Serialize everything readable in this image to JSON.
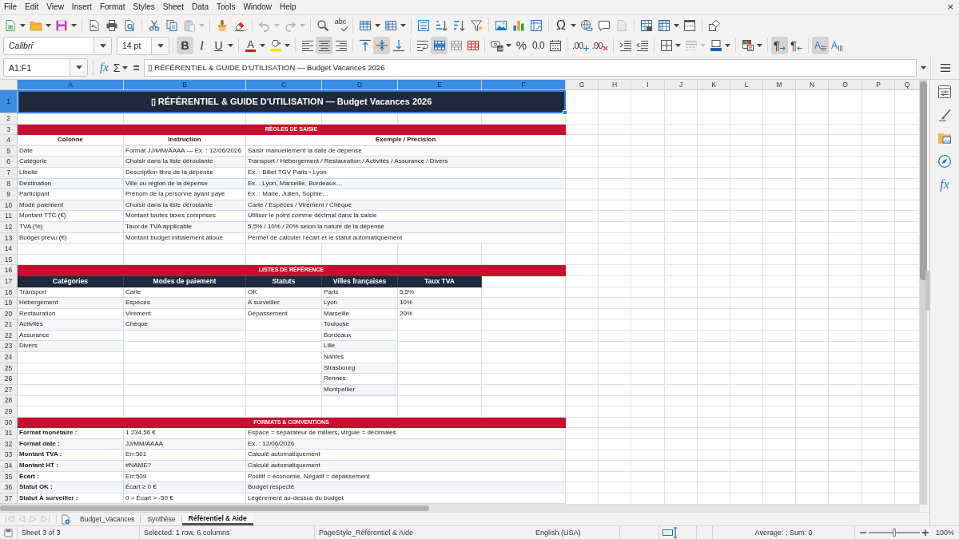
{
  "menu_bar": {
    "items": [
      "File",
      "Edit",
      "View",
      "Insert",
      "Format",
      "Styles",
      "Sheet",
      "Data",
      "Tools",
      "Window",
      "Help"
    ],
    "close": "×"
  },
  "standard_toolbar": {
    "groups": [
      [
        {
          "kind": "new",
          "dropdown": true,
          "disabled": false
        },
        {
          "kind": "open",
          "dropdown": true,
          "disabled": false
        },
        {
          "kind": "save",
          "dropdown": true,
          "disabled": false
        }
      ],
      [
        {
          "kind": "pdf",
          "dropdown": false,
          "disabled": false
        },
        {
          "kind": "print",
          "dropdown": false,
          "disabled": false
        },
        {
          "kind": "preview",
          "dropdown": false,
          "disabled": false
        }
      ],
      [
        {
          "kind": "cut",
          "dropdown": false,
          "disabled": false
        },
        {
          "kind": "copy",
          "dropdown": false,
          "disabled": false
        },
        {
          "kind": "paste",
          "dropdown": true,
          "disabled": true
        }
      ],
      [
        {
          "kind": "clone",
          "dropdown": false,
          "disabled": false
        },
        {
          "kind": "clear",
          "dropdown": false,
          "disabled": false
        }
      ],
      [
        {
          "kind": "undo",
          "dropdown": true,
          "disabled": true
        },
        {
          "kind": "redo",
          "dropdown": true,
          "disabled": true
        }
      ],
      [
        {
          "kind": "find",
          "dropdown": false,
          "disabled": false
        },
        {
          "kind": "spelling",
          "label": "abc",
          "dropdown": false,
          "disabled": false
        }
      ],
      [
        {
          "kind": "rows",
          "dropdown": true,
          "disabled": false
        },
        {
          "kind": "columns",
          "dropdown": true,
          "disabled": false
        }
      ],
      [
        {
          "kind": "sort",
          "dropdown": false,
          "disabled": false
        },
        {
          "kind": "ascending",
          "dropdown": false,
          "disabled": false
        },
        {
          "kind": "descending",
          "dropdown": false,
          "disabled": false
        },
        {
          "kind": "filter",
          "dropdown": false,
          "disabled": false
        }
      ],
      [
        {
          "kind": "image",
          "dropdown": false,
          "disabled": false
        },
        {
          "kind": "chart",
          "dropdown": false,
          "disabled": false
        },
        {
          "kind": "pivot",
          "dropdown": false,
          "disabled": false
        }
      ],
      [
        {
          "kind": "special",
          "label": "Ω",
          "dropdown": true,
          "disabled": false
        },
        {
          "kind": "link",
          "dropdown": false,
          "disabled": false
        },
        {
          "kind": "comment",
          "dropdown": false,
          "disabled": false
        },
        {
          "kind": "headers",
          "dropdown": false,
          "disabled": true
        }
      ],
      [
        {
          "kind": "printarea",
          "dropdown": false,
          "disabled": false
        },
        {
          "kind": "freeze",
          "dropdown": true,
          "disabled": false
        },
        {
          "kind": "split",
          "dropdown": false,
          "disabled": false
        }
      ],
      [
        {
          "kind": "shapes",
          "dropdown": false,
          "disabled": false
        }
      ]
    ]
  },
  "formatting_toolbar": {
    "font_name": "Calibri",
    "font_size": "14 pt",
    "groups": [
      [
        {
          "kind": "bold",
          "label": "B",
          "on": true,
          "dropdown": false,
          "disabled": false
        },
        {
          "kind": "italic",
          "label": "I",
          "on": false,
          "dropdown": false,
          "disabled": false
        },
        {
          "kind": "underline",
          "label": "U",
          "on": false,
          "dropdown": true,
          "disabled": false
        }
      ],
      [
        {
          "kind": "fontcolor",
          "label": "A",
          "on": false,
          "dropdown": true,
          "disabled": false
        },
        {
          "kind": "highlight",
          "on": false,
          "dropdown": true,
          "disabled": false
        }
      ],
      [
        {
          "kind": "left",
          "on": false,
          "dropdown": false,
          "disabled": false
        },
        {
          "kind": "center",
          "on": true,
          "dropdown": false,
          "disabled": false
        },
        {
          "kind": "right",
          "on": false,
          "dropdown": false,
          "disabled": false
        }
      ],
      [
        {
          "kind": "top",
          "on": false,
          "dropdown": false,
          "disabled": false
        },
        {
          "kind": "middle",
          "on": true,
          "dropdown": false,
          "disabled": false
        },
        {
          "kind": "bottom",
          "on": false,
          "dropdown": false,
          "disabled": false
        }
      ],
      [
        {
          "kind": "wrap",
          "on": false,
          "dropdown": false,
          "disabled": false
        },
        {
          "kind": "mergecenter",
          "on": true,
          "dropdown": false,
          "disabled": false
        },
        {
          "kind": "merge",
          "on": false,
          "dropdown": false,
          "disabled": false
        },
        {
          "kind": "unmerge",
          "on": false,
          "dropdown": false,
          "disabled": false
        }
      ],
      [
        {
          "kind": "currency",
          "on": false,
          "dropdown": true,
          "disabled": false
        },
        {
          "kind": "percent",
          "label": "%",
          "on": false,
          "dropdown": false,
          "disabled": false
        },
        {
          "kind": "decimal",
          "label": "0.0",
          "on": false,
          "dropdown": false,
          "disabled": false
        },
        {
          "kind": "date",
          "on": false,
          "dropdown": false,
          "disabled": false
        }
      ],
      [
        {
          "kind": "adddec",
          "label": ".00",
          "on": false,
          "dropdown": false,
          "disabled": false
        },
        {
          "kind": "deldec",
          "label": ".00",
          "on": false,
          "dropdown": false,
          "disabled": false
        }
      ],
      [
        {
          "kind": "indent",
          "on": false,
          "dropdown": false,
          "disabled": false
        },
        {
          "kind": "outdent",
          "on": false,
          "dropdown": false,
          "disabled": false
        }
      ],
      [
        {
          "kind": "borders",
          "on": false,
          "dropdown": true,
          "disabled": false
        },
        {
          "kind": "borderstyle",
          "on": false,
          "dropdown": true,
          "disabled": true
        },
        {
          "kind": "bordercolor",
          "on": false,
          "dropdown": true,
          "disabled": false
        }
      ],
      [
        {
          "kind": "conditional",
          "on": false,
          "dropdown": true,
          "disabled": false
        }
      ],
      [
        {
          "kind": "ltr",
          "label": "¶",
          "on": true,
          "dropdown": false,
          "disabled": false
        },
        {
          "kind": "rtl",
          "label": "¶",
          "on": false,
          "dropdown": false,
          "disabled": false
        }
      ],
      [
        {
          "kind": "textltr",
          "label": "A",
          "on": true,
          "dropdown": false,
          "disabled": false
        },
        {
          "kind": "textttb",
          "label": "A",
          "on": false,
          "dropdown": false,
          "disabled": false
        }
      ]
    ]
  },
  "formula_bar": {
    "name_box": "A1:F1",
    "function_wizard": "fx",
    "sum": "Σ",
    "formula": "=",
    "content": "▯ RÉFÉRENTIEL & GUIDE D'UTILISATION — Budget Vacances 2026"
  },
  "sheet": {
    "columns": [
      {
        "label": "A",
        "selected": true
      },
      {
        "label": "B",
        "selected": true
      },
      {
        "label": "C",
        "selected": true
      },
      {
        "label": "D",
        "selected": true
      },
      {
        "label": "E",
        "selected": true
      },
      {
        "label": "F",
        "selected": true
      },
      {
        "label": "G",
        "selected": false
      },
      {
        "label": "H",
        "selected": false
      },
      {
        "label": "I",
        "selected": false
      },
      {
        "label": "J",
        "selected": false
      },
      {
        "label": "K",
        "selected": false
      },
      {
        "label": "L",
        "selected": false
      },
      {
        "label": "M",
        "selected": false
      },
      {
        "label": "N",
        "selected": false
      },
      {
        "label": "O",
        "selected": false
      },
      {
        "label": "P",
        "selected": false
      },
      {
        "label": "Q",
        "selected": false
      }
    ],
    "rows": [
      {
        "label": "1",
        "selected": true
      },
      {
        "label": "2",
        "selected": false
      },
      {
        "label": "3",
        "selected": false
      },
      {
        "label": "4",
        "selected": false
      },
      {
        "label": "5",
        "selected": false
      },
      {
        "label": "6",
        "selected": false
      },
      {
        "label": "7",
        "selected": false
      },
      {
        "label": "8",
        "selected": false
      },
      {
        "label": "9",
        "selected": false
      },
      {
        "label": "10",
        "selected": false
      },
      {
        "label": "11",
        "selected": false
      },
      {
        "label": "12",
        "selected": false
      },
      {
        "label": "13",
        "selected": false
      },
      {
        "label": "14",
        "selected": false
      },
      {
        "label": "15",
        "selected": false
      },
      {
        "label": "16",
        "selected": false
      },
      {
        "label": "17",
        "selected": false
      },
      {
        "label": "18",
        "selected": false
      },
      {
        "label": "19",
        "selected": false
      },
      {
        "label": "20",
        "selected": false
      },
      {
        "label": "21",
        "selected": false
      },
      {
        "label": "22",
        "selected": false
      },
      {
        "label": "23",
        "selected": false
      },
      {
        "label": "24",
        "selected": false
      },
      {
        "label": "25",
        "selected": false
      },
      {
        "label": "26",
        "selected": false
      },
      {
        "label": "27",
        "selected": false
      },
      {
        "label": "28",
        "selected": false
      },
      {
        "label": "29",
        "selected": false
      },
      {
        "label": "30",
        "selected": false
      },
      {
        "label": "31",
        "selected": false
      },
      {
        "label": "32",
        "selected": false
      },
      {
        "label": "33",
        "selected": false
      },
      {
        "label": "34",
        "selected": false
      },
      {
        "label": "35",
        "selected": false
      },
      {
        "label": "36",
        "selected": false
      },
      {
        "label": "37",
        "selected": false
      }
    ],
    "title": "▯ RÉFÉRENTIEL & GUIDE D'UTILISATION — Budget Vacances 2026",
    "entry_rules": {
      "heading": "RÈGLES DE SAISIE",
      "columns": [
        "Colonne",
        "Instruction",
        "Exemple / Précision"
      ],
      "rows": [
        [
          "Date",
          "Format JJ/MM/AAAA — Ex. : 12/06/2026",
          "Saisir manuellement la date de dépense"
        ],
        [
          "Catégorie",
          "Choisir dans la liste déroulante",
          "Transport / Hébergement / Restauration / Activités / Assurance / Divers"
        ],
        [
          "Libellé",
          "Description libre de la dépense",
          "Ex. : Billet TGV Paris › Lyon"
        ],
        [
          "Destination",
          "Ville ou région de la dépense",
          "Ex. : Lyon, Marseille, Bordeaux…"
        ],
        [
          "Participant",
          "Prénom de la personne ayant payé",
          "Ex. : Marie, Julien, Sophie…"
        ],
        [
          "Mode paiement",
          "Choisir dans la liste déroulante",
          "Carte / Espèces / Virement / Chèque"
        ],
        [
          "Montant TTC (€)",
          "Montant toutes taxes comprises",
          "Utiliser le point comme décimal dans la saisie"
        ],
        [
          "TVA (%)",
          "Taux de TVA applicable",
          "5,5% / 10% / 20% selon la nature de la dépense"
        ],
        [
          "Budget prévu (€)",
          "Montant budget initialement alloué",
          "Permet de calculer l'écart et le statut automatiquement"
        ]
      ]
    },
    "reference_lists": {
      "heading": "LISTES DE RÉFÉRENCE",
      "lists": [
        {
          "heading": "Catégories",
          "items": [
            "Transport",
            "Hébergement",
            "Restauration",
            "Activités",
            "Assurance",
            "Divers"
          ]
        },
        {
          "heading": "Modes de paiement",
          "items": [
            "Carte",
            "Espèces",
            "Virement",
            "Chèque"
          ]
        },
        {
          "heading": "Statuts",
          "items": [
            "OK",
            "À surveiller",
            "Dépassement"
          ]
        },
        {
          "heading": "Villes françaises",
          "items": [
            "Paris",
            "Lyon",
            "Marseille",
            "Toulouse",
            "Bordeaux",
            "Lille",
            "Nantes",
            "Strasbourg",
            "Rennes",
            "Montpellier"
          ]
        },
        {
          "heading": "Taux TVA",
          "items": [
            "5,5%",
            "10%",
            "20%"
          ]
        }
      ]
    },
    "formats": {
      "heading": "FORMATS & CONVENTIONS",
      "rows": [
        {
          "label": "Format monétaire :",
          "value": "1 234,56 €",
          "note": "Espace = séparateur de milliers, virgule = décimales"
        },
        {
          "label": "Format date :",
          "value": "JJ/MM/AAAA",
          "note": "Ex. : 12/06/2026"
        },
        {
          "label": "Montant TVA :",
          "value": "Err:501",
          "note": "Calculé automatiquement"
        },
        {
          "label": "Montant HT :",
          "value": "#NAME?",
          "note": "Calculé automatiquement"
        },
        {
          "label": "Écart :",
          "value": "Err:509",
          "note": "Positif = économie, Négatif = dépassement"
        },
        {
          "label": "Statut OK :",
          "value": "Écart ≥ 0 €",
          "note": "Budget respecté"
        },
        {
          "label": "Statut À surveiller :",
          "value": "0 > Écart > -50 €",
          "note": "Légèrement au-dessus du budget"
        }
      ]
    }
  },
  "sidebar": {
    "functions": "fx"
  },
  "sheet_tabs": {
    "navigation_disabled": true,
    "tabs": [
      {
        "label": "Budget_Vacances",
        "selected": false
      },
      {
        "label": "Synthèse",
        "selected": false
      },
      {
        "label": "Référentiel & Aide",
        "selected": true
      }
    ]
  },
  "status_bar": {
    "sheet": "Sheet 3 of 3",
    "selection": "Selected: 1 row, 6 columns",
    "page_style": "PageStyle_Référentiel & Aide",
    "language": "English (USA)",
    "summary": "Average: ; Sum: 0",
    "zoom": {
      "level": 0.5,
      "label": "100%"
    }
  }
}
